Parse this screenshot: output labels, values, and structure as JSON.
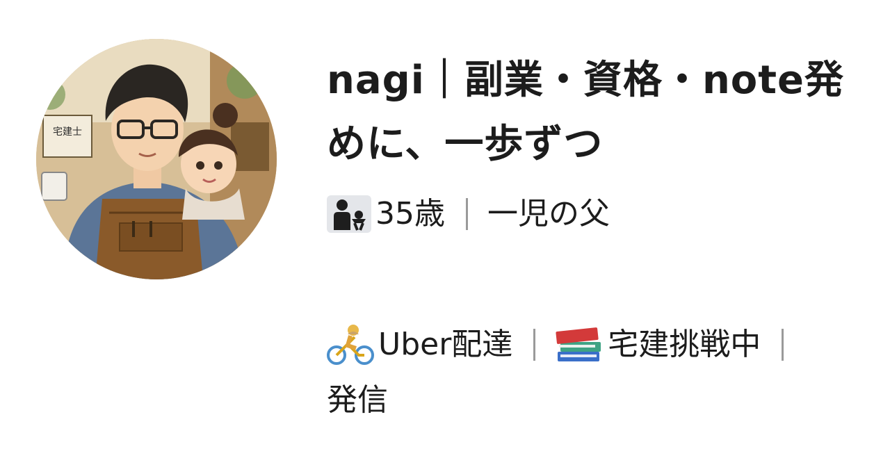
{
  "profile": {
    "avatar_description_icon": "avatar-illustration",
    "title_line_1": "nagi｜副業・資格・note発",
    "title_line_2": "めに、一歩ずつ",
    "age_icon": "parent-child-icon",
    "age_text": "35歳",
    "family_text": "一児の父",
    "bio": {
      "cyclist_icon": "bicyclist-icon",
      "uber_text": "Uber配達",
      "books_icon": "books-icon",
      "study_text": "宅建挑戦中",
      "line_2": "発信"
    }
  }
}
